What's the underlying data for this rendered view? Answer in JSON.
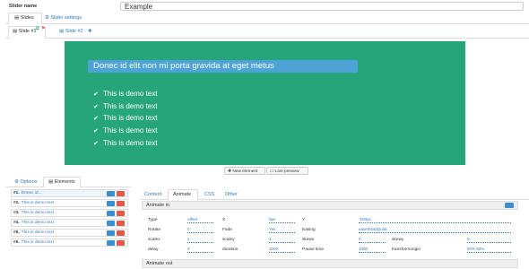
{
  "slider_name": {
    "label": "Slider name",
    "value": "Example"
  },
  "top_tabs": [
    {
      "label": "Slides",
      "active": true
    },
    {
      "label": "Slider settings",
      "active": false
    }
  ],
  "slide_tabs": [
    {
      "label": "Slide #1",
      "active": true
    },
    {
      "label": "Slide #2",
      "active": false
    }
  ],
  "preview": {
    "headline": "Donec id elit non mi porta gravida at eget metus",
    "demo_lines": [
      "This is demo text",
      "This is demo text",
      "This is demo text",
      "This is demo text",
      "This is demo text"
    ],
    "background": "#27a57a",
    "headline_bg": "#4da3d6"
  },
  "preview_buttons": {
    "new_element": "New element",
    "live_preview": "Live preview"
  },
  "lower_tabs": [
    {
      "label": "Options",
      "active": false
    },
    {
      "label": "Elements",
      "active": true
    }
  ],
  "elements": [
    {
      "num": "#1.",
      "label": "Donec id..."
    },
    {
      "num": "#2.",
      "label": "This is demo text"
    },
    {
      "num": "#3.",
      "label": "This is demo text"
    },
    {
      "num": "#4.",
      "label": "This is demo text"
    },
    {
      "num": "#5.",
      "label": "This is demo text"
    },
    {
      "num": "#6.",
      "label": "This is demo text"
    }
  ],
  "element_tabs": [
    {
      "label": "Content",
      "active": false
    },
    {
      "label": "Animate",
      "active": true
    },
    {
      "label": "CSS",
      "active": false
    },
    {
      "label": "Other",
      "active": false
    }
  ],
  "animate_in": {
    "title": "Animate in",
    "rows": [
      [
        {
          "label": "Type",
          "value": "offset"
        },
        {
          "label": "X",
          "value": "0px"
        },
        {
          "label": "Y",
          "value": "-100px"
        }
      ],
      [
        {
          "label": "Rotate",
          "value": "0"
        },
        {
          "label": "Fade",
          "value": "Yes"
        },
        {
          "label": "Easing",
          "value": "easeInOutQuint"
        }
      ],
      [
        {
          "label": "scalex",
          "value": "1"
        },
        {
          "label": "scaley",
          "value": "1"
        },
        {
          "label": "skewx",
          "value": "0"
        },
        {
          "label": "skewy",
          "value": "0"
        }
      ],
      [
        {
          "label": "delay",
          "value": "0"
        },
        {
          "label": "duration",
          "value": "1000"
        },
        {
          "label": "Pause time",
          "value": "1000"
        },
        {
          "label": "transformorigin",
          "value": "50% 50%"
        }
      ]
    ]
  },
  "animate_out": {
    "title": "Animate out"
  },
  "colors": {
    "accent": "#337ab7",
    "delete": "#e05a47",
    "edit": "#3a8fd0"
  }
}
